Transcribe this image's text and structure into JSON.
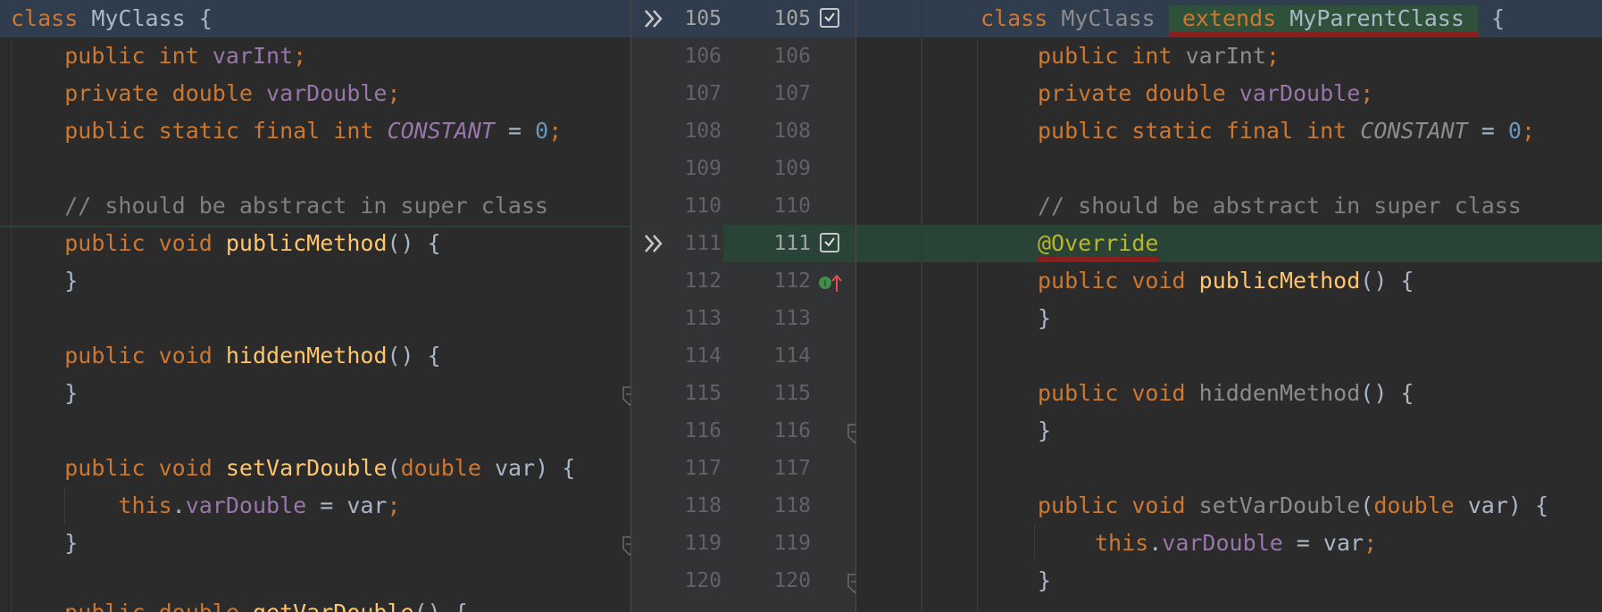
{
  "left": {
    "lines": {
      "l105": {
        "kw": "class",
        "name": "MyClass",
        "brace": "{"
      },
      "l106": {
        "kw1": "public",
        "kw2": "int",
        "field": "varInt",
        "semi": ";"
      },
      "l107": {
        "kw1": "private",
        "kw2": "double",
        "field": "varDouble",
        "semi": ";"
      },
      "l108": {
        "kw1": "public",
        "kw2": "static",
        "kw3": "final",
        "kw4": "int",
        "const": "CONSTANT",
        "eq": "=",
        "num": "0",
        "semi": ";"
      },
      "l110": {
        "comment": "// should be abstract in super class"
      },
      "l111": {
        "kw1": "public",
        "kw2": "void",
        "method": "publicMethod",
        "rest": "() {"
      },
      "l112": {
        "close": "}"
      },
      "l114": {
        "kw1": "public",
        "kw2": "void",
        "method": "hiddenMethod",
        "rest": "() {"
      },
      "l115": {
        "close": "}"
      },
      "l117": {
        "kw1": "public",
        "kw2": "void",
        "method": "setVarDouble",
        "open": "(",
        "ptype": "double",
        "pname": "var",
        "rest": ") {"
      },
      "l118": {
        "this": "this",
        "dot": ".",
        "field": "varDouble",
        "eq": " = var",
        "semi": ";"
      },
      "l119": {
        "close": "}"
      },
      "l121": {
        "kw1": "public",
        "kw2": "double",
        "method": "getVarDouble",
        "rest": "() {"
      }
    }
  },
  "gutter": {
    "rows": [
      {
        "left": "105",
        "right": "105"
      },
      {
        "left": "106",
        "right": "106"
      },
      {
        "left": "107",
        "right": "107"
      },
      {
        "left": "108",
        "right": "108"
      },
      {
        "left": "109",
        "right": "109"
      },
      {
        "left": "110",
        "right": "110"
      },
      {
        "left": "111",
        "right": "111"
      },
      {
        "left": "112",
        "right": "112"
      },
      {
        "left": "113",
        "right": "113"
      },
      {
        "left": "114",
        "right": "114"
      },
      {
        "left": "115",
        "right": "115"
      },
      {
        "left": "116",
        "right": "116"
      },
      {
        "left": "117",
        "right": "117"
      },
      {
        "left": "118",
        "right": "118"
      },
      {
        "left": "119",
        "right": "119"
      },
      {
        "left": "120",
        "right": "120"
      }
    ],
    "icons": {
      "apply_change": "double-chevron-right-icon",
      "checkbox": "checkbox-checked-icon",
      "implementation": "implementation-up-arrow-icon",
      "fold": "fold-marker-icon"
    }
  },
  "right": {
    "lines": {
      "r105": {
        "kw": "class",
        "name": "MyClass",
        "ext": "extends",
        "parent": "MyParentClass",
        "brace": "{"
      },
      "r106": {
        "kw1": "public",
        "kw2": "int",
        "field": "varInt",
        "semi": ";"
      },
      "r107": {
        "kw1": "private",
        "kw2": "double",
        "field": "varDouble",
        "semi": ";"
      },
      "r108": {
        "kw1": "public",
        "kw2": "static",
        "kw3": "final",
        "kw4": "int",
        "const": "CONSTANT",
        "eq": "=",
        "num": "0",
        "semi": ";"
      },
      "r110": {
        "comment": "// should be abstract in super class"
      },
      "r111": {
        "annotation": "@Override"
      },
      "r112": {
        "kw1": "public",
        "kw2": "void",
        "method": "publicMethod",
        "rest": "() {"
      },
      "r113": {
        "close": "}"
      },
      "r115": {
        "kw1": "public",
        "kw2": "void",
        "method": "hiddenMethod",
        "rest": "() {"
      },
      "r116": {
        "close": "}"
      },
      "r118": {
        "kw1": "public",
        "kw2": "void",
        "method": "setVarDouble",
        "open": "(",
        "ptype": "double",
        "pname": "var",
        "rest": ") {"
      },
      "r119": {
        "this": "this",
        "dot": ".",
        "field": "varDouble",
        "eq": " = var",
        "semi": ";"
      },
      "r120": {
        "close": "}"
      }
    }
  },
  "colors": {
    "background": "#2b2b2b",
    "keyword": "#cc7832",
    "field": "#9876aa",
    "method": "#ffc66d",
    "number": "#6897bb",
    "comment": "#808080",
    "annotation": "#bbb529",
    "changed_line": "#294436",
    "current_line": "#2f3d4e",
    "error_underline": "#8a1d1d"
  }
}
